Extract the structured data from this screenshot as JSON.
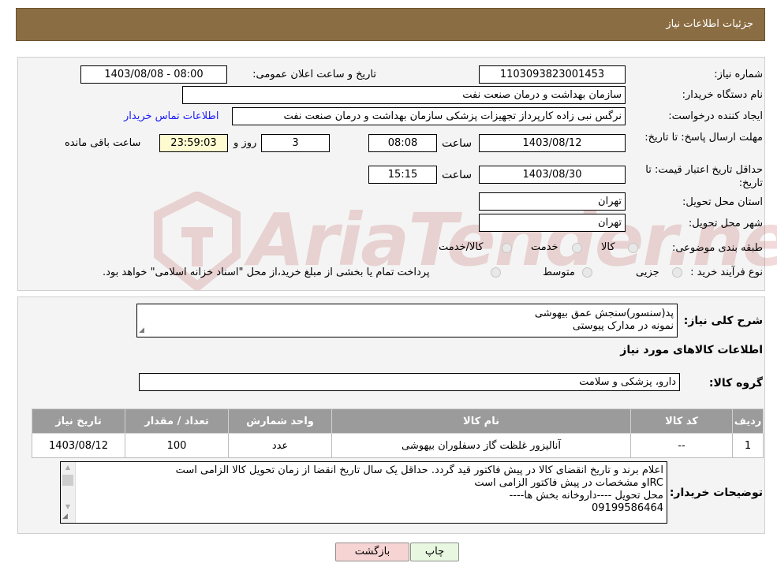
{
  "header": {
    "title": "جزئیات اطلاعات نیاز"
  },
  "form": {
    "need_number_label": "شماره نیاز:",
    "need_number": "1103093823001453",
    "announce_label": "تاریخ و ساعت اعلان عمومی:",
    "announce_value": "1403/08/08 - 08:00",
    "buyer_label": "نام دستگاه خریدار:",
    "buyer_value": "سازمان بهداشت و درمان صنعت نفت",
    "creator_label": "ایجاد کننده درخواست:",
    "creator_value": "نرگس نبی زاده کارپرداز تجهیزات پزشکی سازمان بهداشت و درمان صنعت نفت",
    "contact_link": "اطلاعات تماس خریدار",
    "deadline_label": "مهلت ارسال پاسخ: تا تاریخ:",
    "deadline_date": "1403/08/12",
    "time_label": "ساعت",
    "deadline_time": "08:08",
    "days_value": "3",
    "days_label": "روز و",
    "remaining_time": "23:59:03",
    "remaining_label": "ساعت باقی مانده",
    "validity_label": "حداقل تاریخ اعتبار قیمت: تا تاریخ:",
    "validity_date": "1403/08/30",
    "validity_time": "15:15",
    "province_label": "استان محل تحویل:",
    "province_value": "تهران",
    "city_label": "شهر محل تحویل:",
    "city_value": "تهران",
    "category_label": "طبقه بندی موضوعی:",
    "category_options": [
      "کالا",
      "خدمت",
      "کالا/خدمت"
    ],
    "process_label": "نوع فرآیند خرید :",
    "process_options": [
      "جزیی",
      "متوسط"
    ],
    "process_note": "پرداخت تمام یا بخشی از مبلغ خرید،از محل \"اسناد خزانه اسلامی\" خواهد بود."
  },
  "watermark": {
    "text": "AriaTender.neT"
  },
  "description": {
    "label": "شرح کلی نیاز:",
    "lines": [
      "پد(سنسور)سنجش عمق بیهوشی",
      "نمونه در مدارک پیوستی"
    ]
  },
  "items_section": {
    "title": "اطلاعات کالاهای مورد نیاز",
    "group_label": "گروه کالا:",
    "group_value": "دارو، پزشکی و سلامت"
  },
  "table": {
    "columns": [
      "ردیف",
      "کد کالا",
      "نام کالا",
      "واحد شمارش",
      "تعداد / مقدار",
      "تاریخ نیاز"
    ],
    "rows": [
      [
        "1",
        "--",
        "آنالیزور غلظت گاز دسفلوران بیهوشی",
        "عدد",
        "100",
        "1403/08/12"
      ]
    ]
  },
  "buyer_notes": {
    "label": "توضیحات خریدار:",
    "lines": [
      "اعلام برند و تاریخ انقضای کالا در پیش فاکتور قید گردد. حداقل یک سال تاریخ انقضا از زمان تحویل کالا  الزامی است",
      "IRCو مشخصات در پیش فاکتور الزامی است",
      "محل تحویل ----داروخانه بخش ها----",
      "09199586464"
    ]
  },
  "buttons": {
    "back": "بازگشت",
    "print": "چاپ"
  },
  "colors": {
    "header": "#8b6d43",
    "link": "#1a1aff",
    "back_button": "#f7d4d4",
    "print_button": "#e8f7e0"
  }
}
